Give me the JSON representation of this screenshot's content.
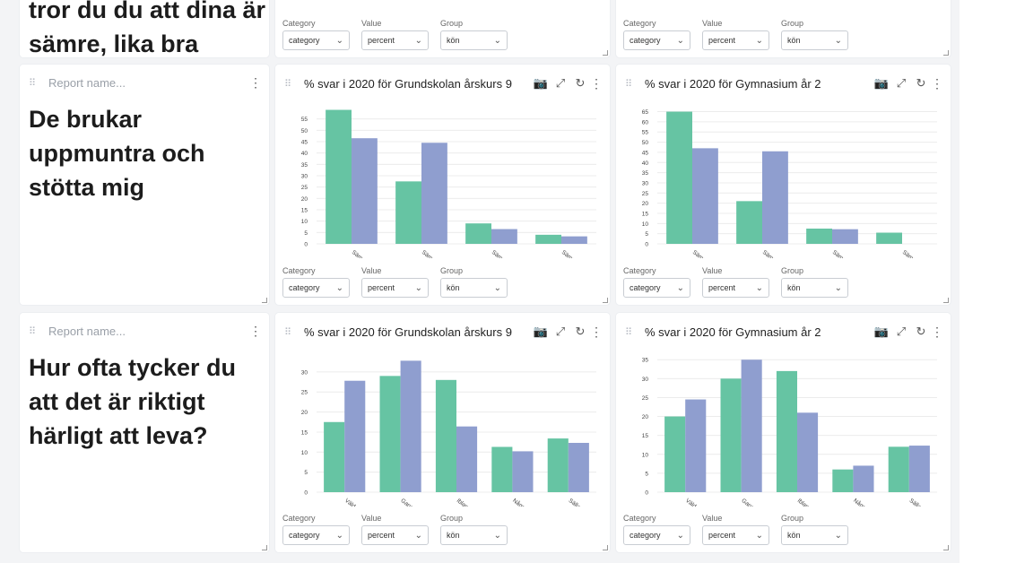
{
  "colors": {
    "green": "#66c4a3",
    "purple": "#8f9ecf",
    "grid": "#ececec"
  },
  "icons": {
    "drag": "drag-handle-icon",
    "menu": "kebab-menu-icon",
    "camera": "camera-icon",
    "expand": "expand-icon",
    "refresh": "refresh-icon",
    "chevron": "chevron-down-icon"
  },
  "controls": {
    "category_label": "Category",
    "category_value": "category",
    "value_label": "Value",
    "value_value": "percent",
    "group_label": "Group",
    "group_value": "kön"
  },
  "rows": [
    {
      "text_card": {
        "text": "tror du du att dina är sämre, lika bra"
      },
      "charts": [
        {
          "title": "",
          "chart_data": {
            "type": "bar",
            "categories": [],
            "series": [],
            "ylim": [
              0,
              60
            ],
            "yticks": []
          }
        },
        {
          "title": "",
          "chart_data": {
            "type": "bar",
            "categories": [],
            "series": [],
            "ylim": [
              0,
              60
            ],
            "yticks": []
          }
        }
      ]
    },
    {
      "text_card": {
        "placeholder": "Report name...",
        "text": "De brukar uppmuntra och stötta mig"
      },
      "charts": [
        {
          "title": "% svar i 2020 för Grundskolan årskurs 9",
          "chart_data": {
            "type": "bar",
            "categories": [
              "Sämr",
              "Sämr",
              "Sämr",
              "Sämr"
            ],
            "series": [
              {
                "values": [
                  59,
                  27.5,
                  9,
                  4
                ]
              },
              {
                "values": [
                  46.5,
                  44.5,
                  6.5,
                  3.3
                ]
              }
            ],
            "ylim": [
              0,
              60
            ],
            "yticks": [
              0,
              5,
              10,
              15,
              20,
              25,
              30,
              35,
              40,
              45,
              50,
              55
            ]
          }
        },
        {
          "title": "% svar i 2020 för Gymnasium år 2",
          "chart_data": {
            "type": "bar",
            "categories": [
              "Sämr",
              "Sämr",
              "Sämr",
              "Sämr"
            ],
            "series": [
              {
                "values": [
                  65,
                  21,
                  7.5,
                  5.5
                ]
              },
              {
                "values": [
                  47,
                  45.5,
                  7.2,
                  0
                ]
              }
            ],
            "ylim": [
              0,
              67
            ],
            "yticks": [
              0,
              5,
              10,
              15,
              20,
              25,
              30,
              35,
              40,
              45,
              50,
              55,
              60,
              65
            ]
          }
        }
      ]
    },
    {
      "text_card": {
        "placeholder": "Report name...",
        "text": "Hur ofta tycker du att det är riktigt härligt att leva?"
      },
      "charts": [
        {
          "title": "% svar i 2020 för Grundskolan årskurs 9",
          "chart_data": {
            "type": "bar",
            "categories": [
              "Väld",
              "Ganz",
              "Ibland",
              "Någo",
              "Sällan"
            ],
            "series": [
              {
                "values": [
                  17.5,
                  29,
                  28,
                  11.3,
                  13.4
                ]
              },
              {
                "values": [
                  27.8,
                  32.8,
                  16.4,
                  10.2,
                  12.3
                ]
              }
            ],
            "ylim": [
              0,
              34
            ],
            "yticks": [
              0,
              5,
              10,
              15,
              20,
              25,
              30
            ]
          }
        },
        {
          "title": "% svar i 2020 för Gymnasium år 2",
          "chart_data": {
            "type": "bar",
            "categories": [
              "Väld",
              "Ganz",
              "Ibland",
              "Någo",
              "Sällan"
            ],
            "series": [
              {
                "values": [
                  20,
                  30,
                  32,
                  6,
                  12
                ]
              },
              {
                "values": [
                  24.5,
                  35,
                  21,
                  7,
                  12.3
                ]
              }
            ],
            "ylim": [
              0,
              36
            ],
            "yticks": [
              0,
              5,
              10,
              15,
              20,
              25,
              30,
              35
            ]
          }
        }
      ]
    }
  ]
}
